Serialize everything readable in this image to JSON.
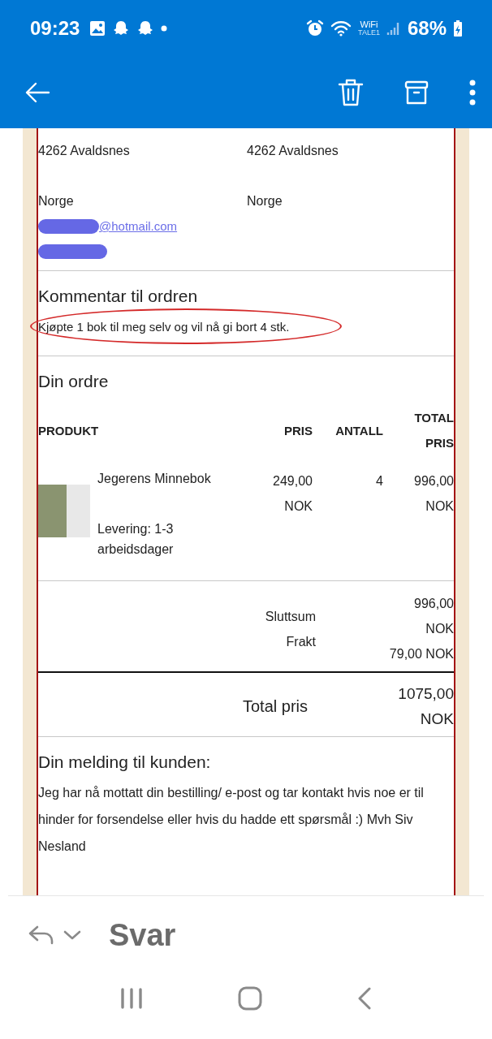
{
  "status_bar": {
    "time": "09:23",
    "wifi_label": "WiFi",
    "wifi_sublabel": "TALE1",
    "battery": "68%"
  },
  "addresses": [
    {
      "lines": [
        "4262 Avaldsnes",
        "Norge"
      ],
      "email": "@hotmail.com",
      "redacted": true
    },
    {
      "lines": [
        "4262 Avaldsnes",
        "Norge"
      ],
      "redacted": false
    }
  ],
  "comment": {
    "heading": "Kommentar til ordren",
    "text": "Kjøpte 1 bok til meg selv og vil nå gi bort 4 stk.",
    "circled": true
  },
  "order": {
    "heading": "Din ordre",
    "columns": [
      "PRODUKT",
      "PRIS",
      "ANTALL",
      "TOTAL PRIS"
    ],
    "rows": [
      {
        "name": "Jegerens Minnebok",
        "delivery": "Levering: 1-3 arbeidsdager",
        "price": "249,00 NOK",
        "quantity": "4",
        "total": "996,00 NOK"
      }
    ],
    "summary_labels": [
      "Sluttsum",
      "Frakt"
    ],
    "summary_values": [
      "996,00 NOK",
      "79,00 NOK"
    ],
    "total_label": "Total pris",
    "total_value": "1075,00 NOK"
  },
  "message": {
    "heading": "Din melding til kunden:",
    "text": "Jeg har nå mottatt din bestilling/ e-post og tar kontakt hvis noe er til hinder for forsendelse eller hvis du hadde ett spørsmål :) Mvh Siv Nesland"
  },
  "reply_bar": {
    "label": "Svar"
  }
}
